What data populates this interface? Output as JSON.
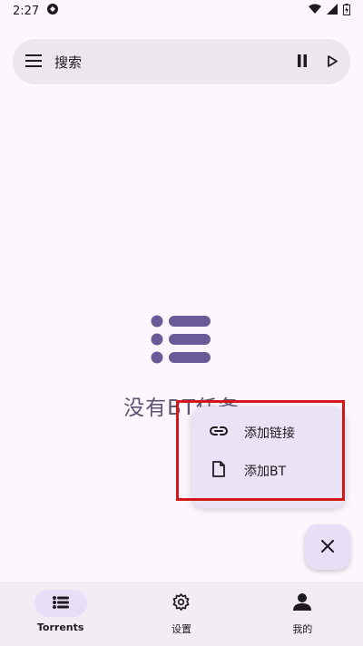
{
  "status_bar": {
    "time": "2:27"
  },
  "search": {
    "placeholder": "搜索"
  },
  "empty_state": {
    "message": "没有BT任务"
  },
  "fab_menu": {
    "items": [
      {
        "label": "添加链接",
        "icon": "link-icon"
      },
      {
        "label": "添加BT",
        "icon": "file-icon"
      }
    ]
  },
  "bottom_nav": {
    "items": [
      {
        "label": "Torrents",
        "icon": "list-icon",
        "active": true
      },
      {
        "label": "设置",
        "icon": "gear-icon",
        "active": false
      },
      {
        "label": "我的",
        "icon": "person-icon",
        "active": false
      }
    ]
  },
  "colors": {
    "background": "#fdf7fd",
    "accent": "#6a5a98",
    "highlight": "#d21818"
  }
}
